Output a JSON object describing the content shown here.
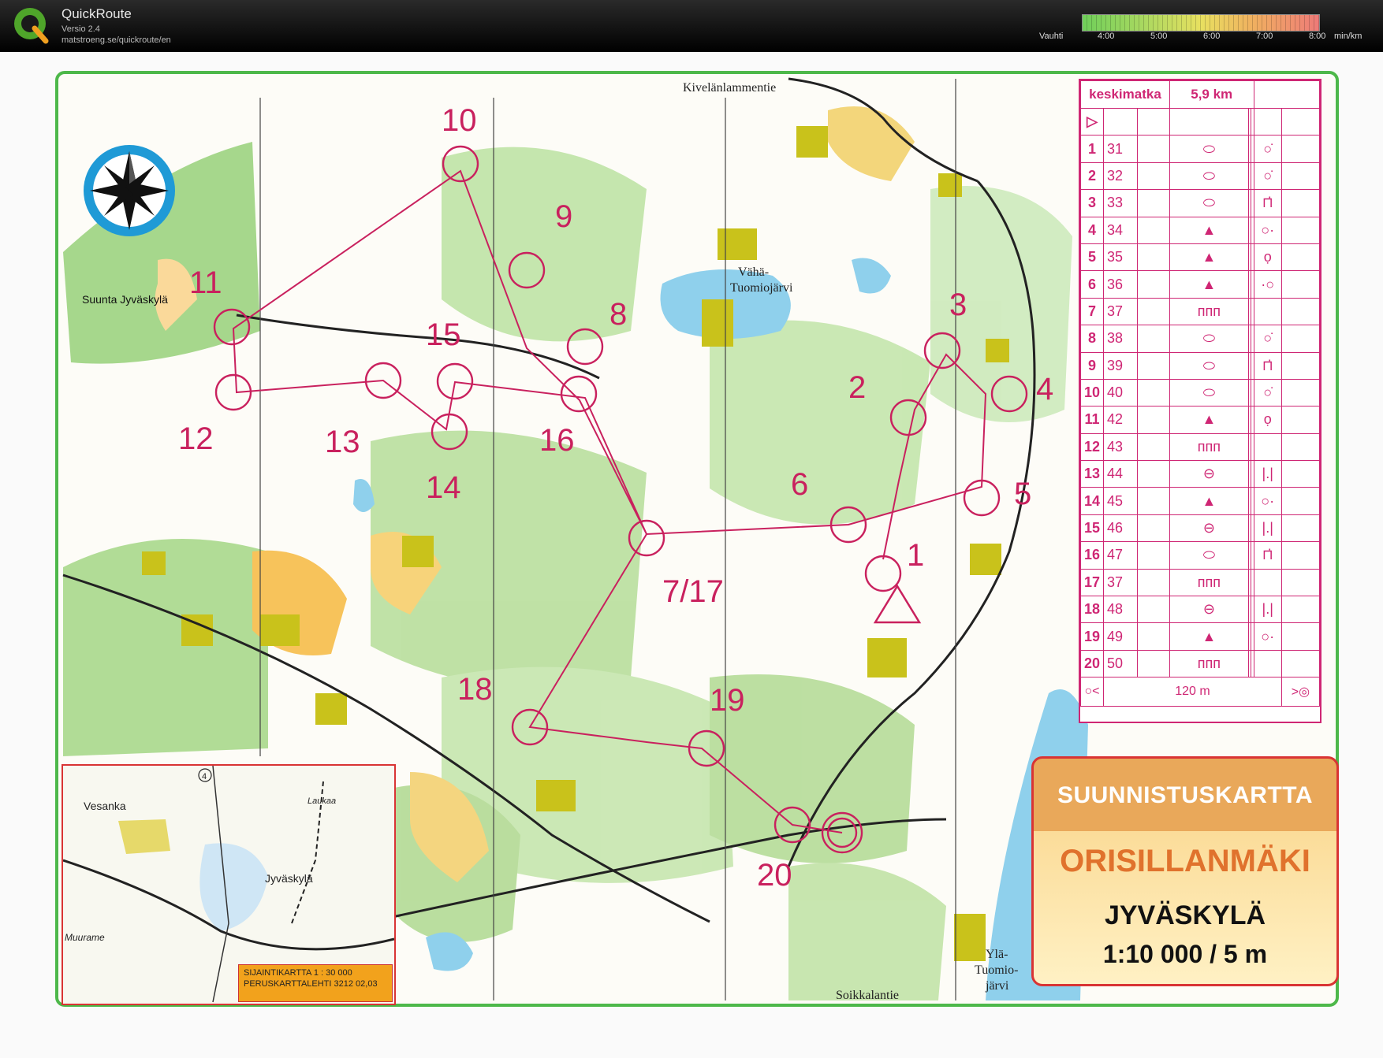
{
  "app": {
    "name": "QuickRoute",
    "version": "Versio 2.4",
    "url": "matstroeng.se/quickroute/en"
  },
  "pace_legend": {
    "label": "Vauhti",
    "ticks": [
      "4:00",
      "5:00",
      "6:00",
      "7:00",
      "8:00"
    ],
    "unit": "min/km"
  },
  "map": {
    "compass_label": "Suunta Jyväskylä",
    "place_names": [
      "Kivelänlammentie",
      "Vähä-",
      "Tuomiojärvi",
      "Soikkalantie",
      "Ylä-",
      "Tuomio-",
      "järvi"
    ],
    "control_labels": [
      "1",
      "2",
      "3",
      "4",
      "5",
      "6",
      "7/17",
      "8",
      "9",
      "10",
      "11",
      "12",
      "13",
      "14",
      "15",
      "16",
      "18",
      "19",
      "20"
    ],
    "accent_color": "#c9215e",
    "frame_color": "#4db84a"
  },
  "control_description": {
    "course": "keskimatka",
    "length": "5,9 km",
    "rows": [
      {
        "n": "1",
        "code": "31",
        "feature": "⬭",
        "detail": "○̇"
      },
      {
        "n": "2",
        "code": "32",
        "feature": "⬭",
        "detail": "○̇"
      },
      {
        "n": "3",
        "code": "33",
        "feature": "⬭",
        "detail": "⊓̇"
      },
      {
        "n": "4",
        "code": "34",
        "feature": "▲",
        "detail": "○·"
      },
      {
        "n": "5",
        "code": "35",
        "feature": "▲",
        "detail": "ọ"
      },
      {
        "n": "6",
        "code": "36",
        "feature": "▲",
        "detail": "·○"
      },
      {
        "n": "7",
        "code": "37",
        "feature": "ᴨᴨᴨ",
        "detail": ""
      },
      {
        "n": "8",
        "code": "38",
        "feature": "⬭",
        "detail": "○̇"
      },
      {
        "n": "9",
        "code": "39",
        "feature": "⬭",
        "detail": "⊓̇"
      },
      {
        "n": "10",
        "code": "40",
        "feature": "⬭",
        "detail": "○̇"
      },
      {
        "n": "11",
        "code": "42",
        "feature": "▲",
        "detail": "ọ"
      },
      {
        "n": "12",
        "code": "43",
        "feature": "ᴨᴨᴨ",
        "detail": ""
      },
      {
        "n": "13",
        "code": "44",
        "feature": "⊖",
        "detail": "|.|"
      },
      {
        "n": "14",
        "code": "45",
        "feature": "▲",
        "detail": "○·"
      },
      {
        "n": "15",
        "code": "46",
        "feature": "⊖",
        "detail": "|.|"
      },
      {
        "n": "16",
        "code": "47",
        "feature": "⬭",
        "detail": "⊓̇"
      },
      {
        "n": "17",
        "code": "37",
        "feature": "ᴨᴨᴨ",
        "detail": ""
      },
      {
        "n": "18",
        "code": "48",
        "feature": "⊖",
        "detail": "|.|"
      },
      {
        "n": "19",
        "code": "49",
        "feature": "▲",
        "detail": "○·"
      },
      {
        "n": "20",
        "code": "50",
        "feature": "ᴨᴨᴨ",
        "detail": ""
      }
    ],
    "finish_distance": "120 m"
  },
  "title_box": {
    "line1": "SUUNNISTUSKARTTA",
    "line2": "ORISILLANMÄKI",
    "line3": "JYVÄSKYLÄ",
    "line4": "1:10 000 / 5 m"
  },
  "inset": {
    "labels": [
      "Vesanka",
      "Jyväskylä",
      "Muurame",
      "Laukaa",
      "4"
    ],
    "caption1": "SIJAINTIKARTTA   1 : 30 000",
    "caption2": "PERUSKARTTALEHTI 3212 02,03"
  }
}
